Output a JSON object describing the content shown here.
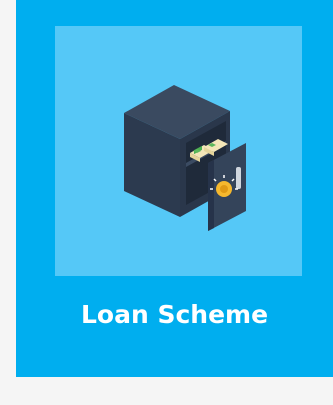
{
  "tile": {
    "label": "Loan Scheme",
    "icon": "open-safe-with-money-icon"
  },
  "colors": {
    "page_background": "#f5f5f5",
    "tile_background": "#00aeef",
    "icon_background": "#55c8f7",
    "label_text": "#ffffff"
  }
}
